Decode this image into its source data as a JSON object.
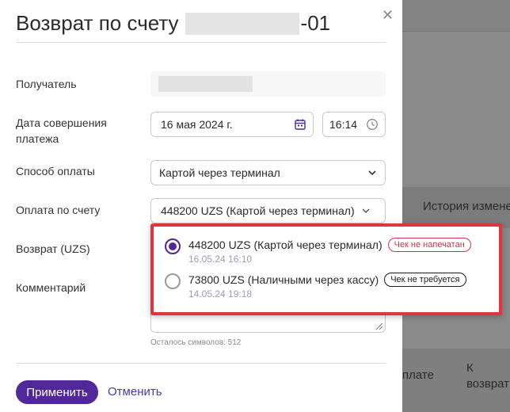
{
  "modal": {
    "title_prefix": "Возврат по счету",
    "title_suffix": "-01"
  },
  "form": {
    "recipient_label": "Получатель",
    "payment_date_label": "Дата совершения платежа",
    "date_value": "16 мая 2024 г.",
    "time_value": "16:14",
    "payment_method_label": "Способ оплаты",
    "payment_method_value": "Картой через терминал",
    "invoice_payment_label": "Оплата по счету",
    "invoice_payment_value": "448200 UZS (Картой через терминал)",
    "refund_label": "Возврат (UZS)",
    "comment_label": "Комментарий",
    "chars_left": "Осталось символов: 512"
  },
  "dropdown": {
    "options": [
      {
        "title": "448200 UZS (Картой через терминал)",
        "date": "16.05.24 16:10",
        "badge": "Чек не напечатан",
        "selected": true
      },
      {
        "title": "73800 UZS (Наличными через кассу)",
        "date": "14.05.24 19:18",
        "badge": "Чек не требуется",
        "selected": false
      }
    ]
  },
  "footer": {
    "apply_label": "Применить",
    "cancel_label": "Отменить"
  },
  "background": {
    "history_text": "История измене",
    "col1_text": "плате",
    "col2_text": "К возврат"
  },
  "colors": {
    "accent": "#51289a",
    "link": "#4e35b6",
    "highlight_border": "#e0353d",
    "badge_red": "#d2354a"
  }
}
